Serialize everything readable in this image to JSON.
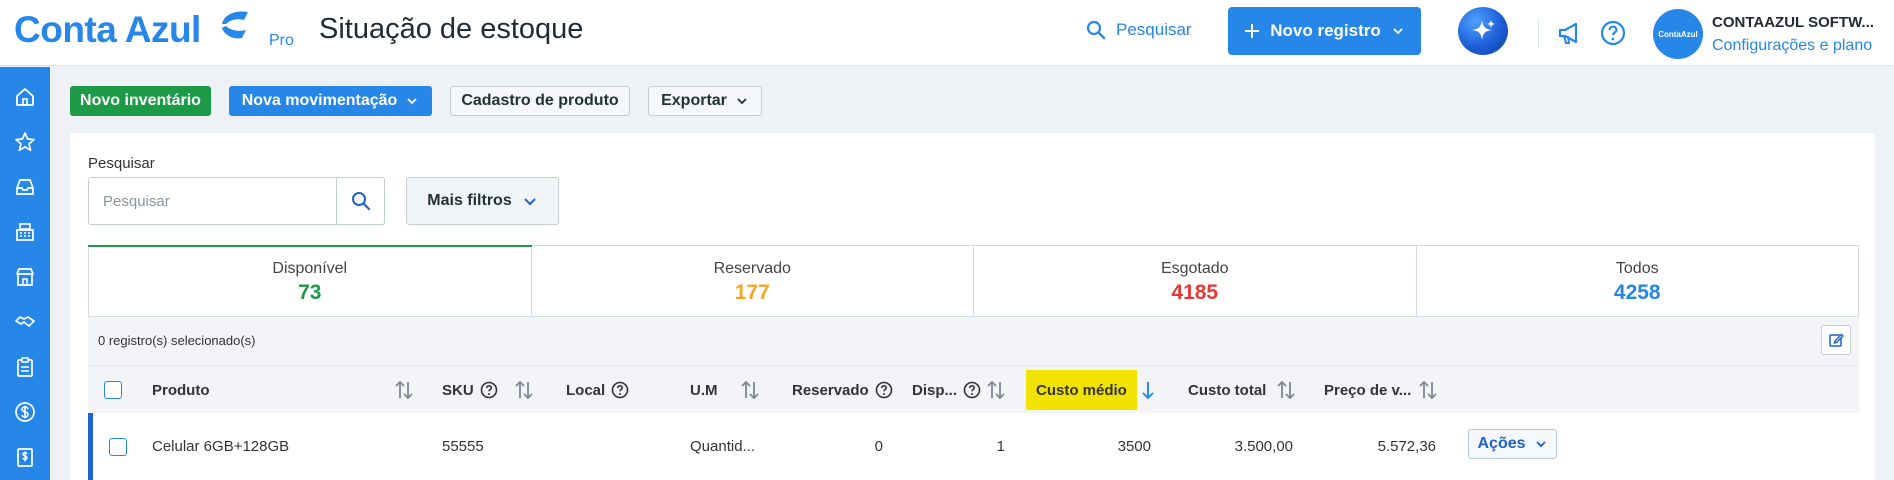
{
  "header": {
    "logo": "Conta Azul",
    "plan_badge": "Pro",
    "page_title": "Situação de estoque",
    "search_label": "Pesquisar",
    "new_record_label": "Novo registro",
    "avatar_text": "ContaAzul",
    "company_name": "CONTAAZUL SOFTW...",
    "config_link": "Configurações e plano"
  },
  "sidebar": {
    "items": [
      "home-icon",
      "star-icon",
      "inbox-icon",
      "cash-register-icon",
      "store-icon",
      "handshake-icon",
      "clipboard-icon",
      "dollar-icon",
      "invoice-icon"
    ]
  },
  "toolbar": {
    "new_inventory": "Novo inventário",
    "new_movement": "Nova movimentação",
    "product_register": "Cadastro de produto",
    "export": "Exportar"
  },
  "filters": {
    "search_label": "Pesquisar",
    "search_placeholder": "Pesquisar",
    "more_filters": "Mais filtros"
  },
  "stats": [
    {
      "label": "Disponível",
      "value": "73",
      "color": "#1c9a48"
    },
    {
      "label": "Reservado",
      "value": "177",
      "color": "#f5a623"
    },
    {
      "label": "Esgotado",
      "value": "4185",
      "color": "#e53935"
    },
    {
      "label": "Todos",
      "value": "4258",
      "color": "#2687e9"
    }
  ],
  "selection": {
    "text": "0 registro(s) selecionado(s)"
  },
  "table": {
    "columns": {
      "produto": "Produto",
      "sku": "SKU",
      "local": "Local",
      "um": "U.M",
      "reservado": "Reservado",
      "disp": "Disp...",
      "custo_medio": "Custo médio",
      "custo_total": "Custo total",
      "preco": "Preço de v..."
    },
    "rows": [
      {
        "produto": "Celular 6GB+128GB",
        "sku": "55555",
        "local": "",
        "um": "Quantid...",
        "reservado": "0",
        "disp": "1",
        "custo_medio": "3500",
        "custo_total": "3.500,00",
        "preco": "5.572,36",
        "acoes": "Ações"
      }
    ]
  }
}
